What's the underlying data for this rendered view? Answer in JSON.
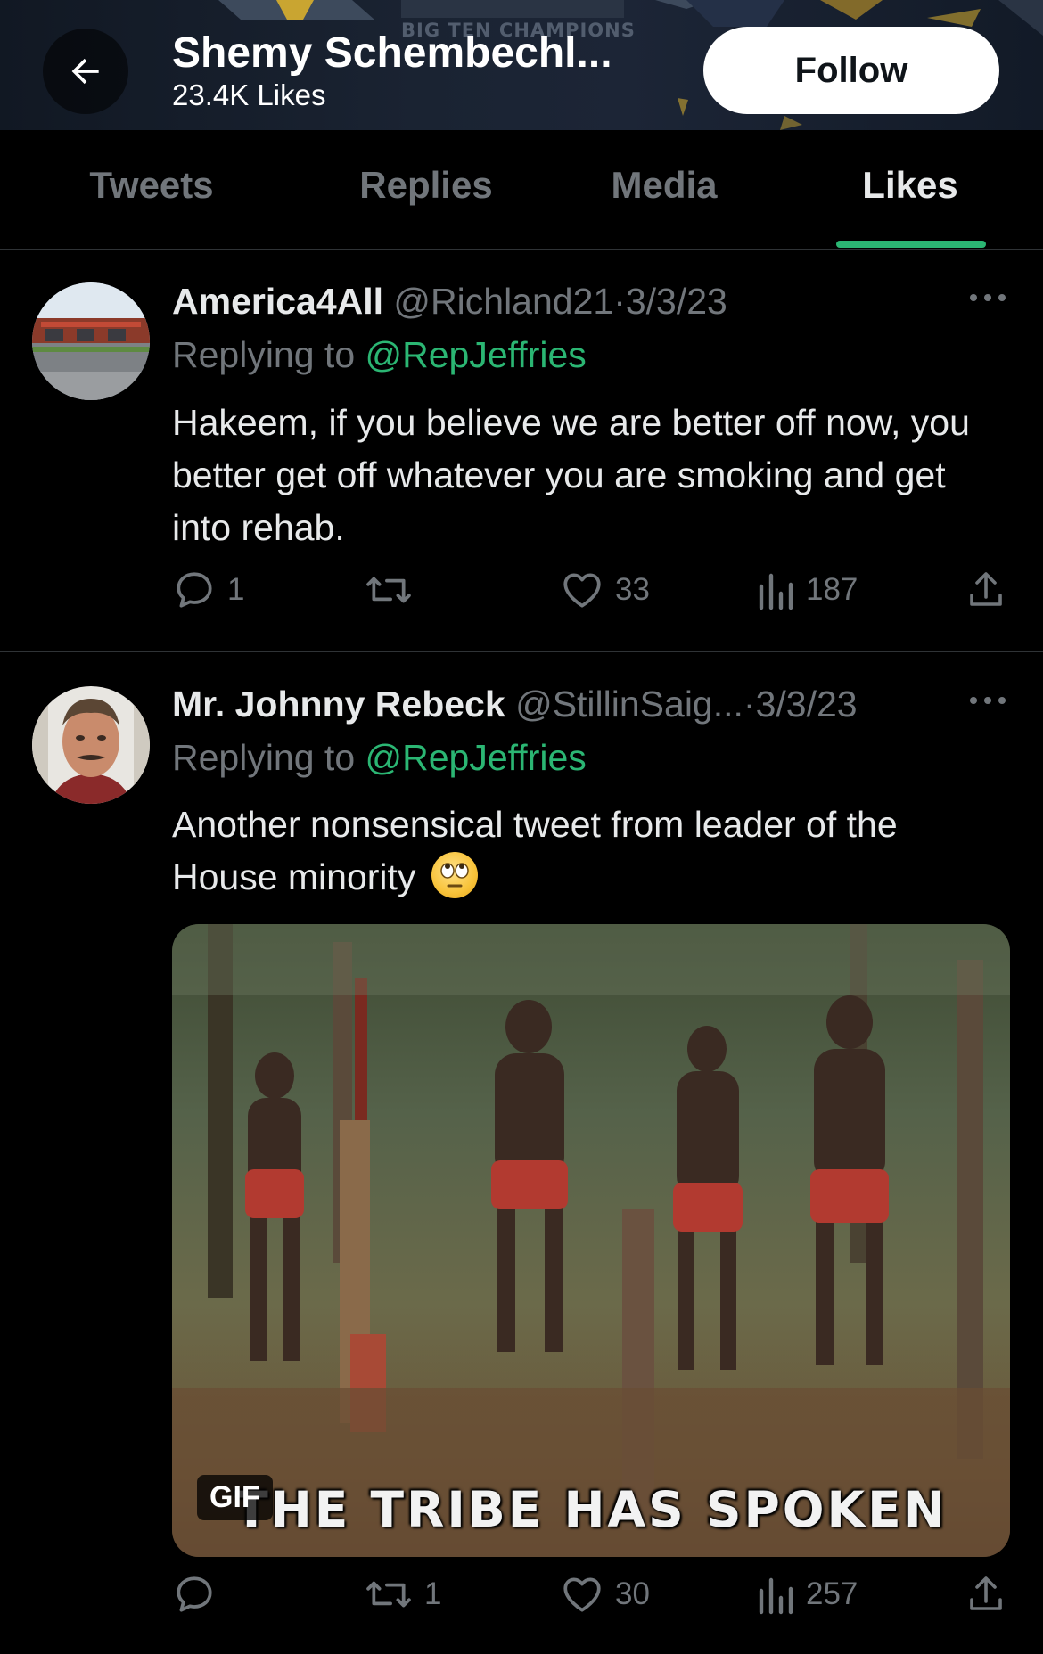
{
  "header": {
    "back_icon": "arrow-left-icon",
    "name": "Shemy Schembechl...",
    "likes_count": "23.4K Likes",
    "follow_label": "Follow",
    "banner_text": "BIG TEN CHAMPIONS"
  },
  "tabs": [
    {
      "label": "Tweets",
      "active": false
    },
    {
      "label": "Replies",
      "active": false
    },
    {
      "label": "Media",
      "active": false
    },
    {
      "label": "Likes",
      "active": true
    }
  ],
  "colors": {
    "accent": "#2bb673",
    "text": "#e7e9ea",
    "muted": "#71767b",
    "background": "#000000"
  },
  "tweets": [
    {
      "author": "America4All",
      "handle": "@Richland21",
      "date": "·3/3/23",
      "replying_prefix": "Replying to ",
      "replying_to": "@RepJeffries",
      "text": "Hakeem, if you believe we are better off now, you better get off whatever you are smoking and get into rehab.",
      "replies": "1",
      "retweets": "",
      "likes": "33",
      "views": "187"
    },
    {
      "author": "Mr. Johnny Rebeck",
      "handle": "@StillinSaig...",
      "date": "·3/3/23",
      "replying_prefix": "Replying to ",
      "replying_to": "@RepJeffries",
      "text": "Another nonsensical tweet from leader of the House minority",
      "emoji": "face-with-rolling-eyes",
      "media": {
        "badge": "GIF",
        "caption": "THE TRIBE HAS SPOKEN"
      },
      "replies": "",
      "retweets": "1",
      "likes": "30",
      "views": "257"
    }
  ],
  "icons": [
    "reply-icon",
    "retweet-icon",
    "like-icon",
    "views-icon",
    "share-icon",
    "more-icon"
  ]
}
